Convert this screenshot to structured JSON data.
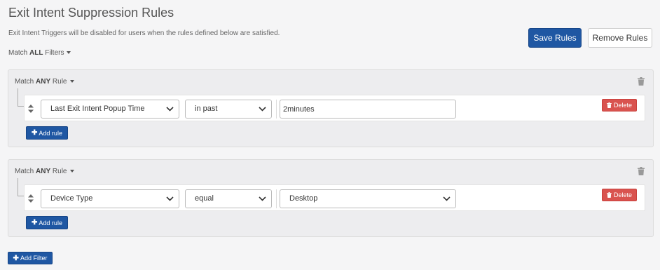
{
  "page": {
    "title": "Exit Intent Suppression Rules",
    "subtitle": "Exit Intent Triggers will be disabled for users when the rules defined below are satisfied.",
    "match_prefix": "Match",
    "match_mode": "ALL",
    "match_suffix": "Filters"
  },
  "toolbar": {
    "save_label": "Save Rules",
    "remove_label": "Remove Rules"
  },
  "groups": [
    {
      "match_prefix": "Match",
      "match_mode": "ANY",
      "match_suffix": "Rule",
      "rule": {
        "field": "Last Exit Intent Popup Time",
        "operator": "in past",
        "value": "2minutes",
        "value_type": "text",
        "delete_label": "Delete"
      },
      "add_rule_label": "Add rule"
    },
    {
      "match_prefix": "Match",
      "match_mode": "ANY",
      "match_suffix": "Rule",
      "rule": {
        "field": "Device Type",
        "operator": "equal",
        "value": "Desktop",
        "value_type": "select",
        "delete_label": "Delete"
      },
      "add_rule_label": "Add rule"
    }
  ],
  "footer": {
    "add_filter_label": "Add Filter"
  },
  "colors": {
    "primary": "#1f57a3",
    "danger": "#d9534f",
    "background": "#f5f5f6",
    "group_background": "#ededef"
  },
  "icons": [
    "trash-icon",
    "drag-handle-icon",
    "chevron-down-icon",
    "plus-icon",
    "caret-down-icon"
  ]
}
